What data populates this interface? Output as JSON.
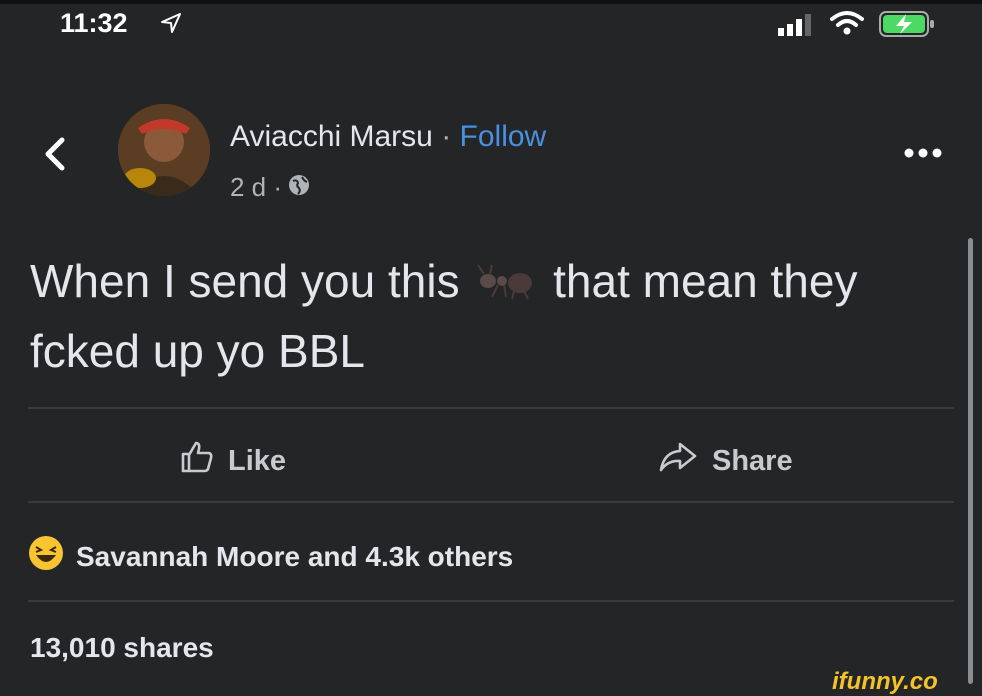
{
  "status_bar": {
    "time": "11:32"
  },
  "post": {
    "author": "Aviacchi Marsu",
    "separator": " · ",
    "follow_label": "Follow",
    "age": "2 d ·",
    "text_before": "When I send you this",
    "text_after": "that mean they fcked up yo BBL",
    "emoji_icon": "ant-emoji"
  },
  "actions": {
    "like_label": "Like",
    "share_label": "Share"
  },
  "reactions": {
    "text": "Savannah Moore and 4.3k others",
    "icon": "laughing-emoji"
  },
  "shares": {
    "text": "13,010 shares"
  },
  "watermark": "ifunny.co",
  "colors": {
    "background": "#242526",
    "follow": "#4a90e2",
    "divider": "#3a3b3c"
  }
}
